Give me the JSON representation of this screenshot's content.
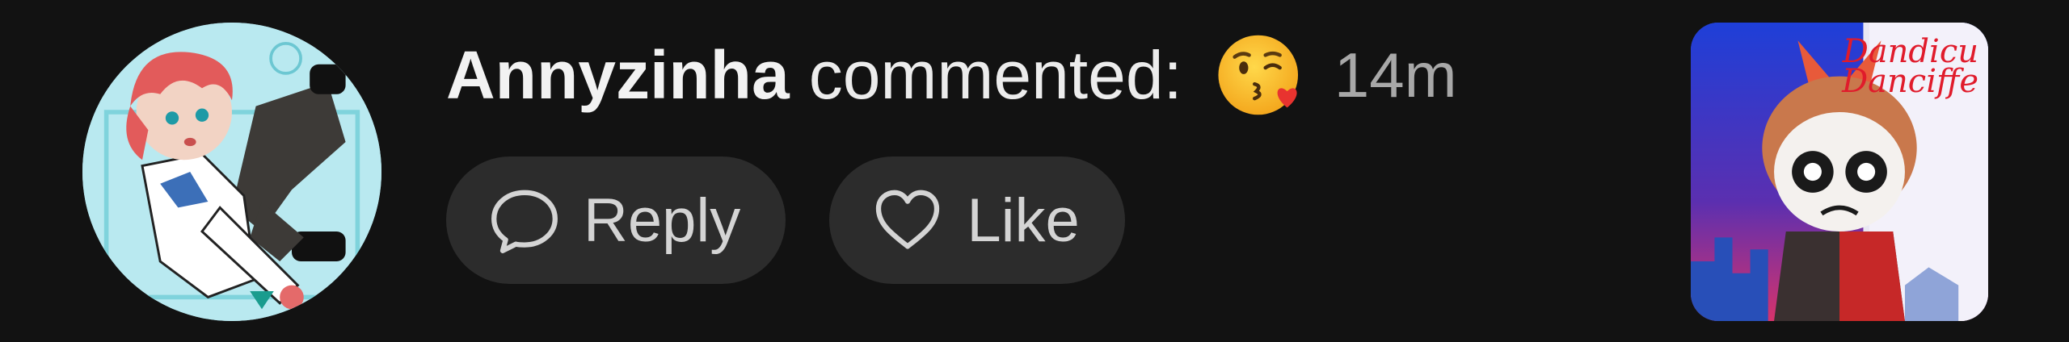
{
  "notification": {
    "author": "Annyzinha",
    "action": "commented:",
    "emoji": "face-blowing-a-kiss",
    "time": "14m"
  },
  "buttons": {
    "reply_label": "Reply",
    "like_label": "Like"
  },
  "thumbnail": {
    "caption_line1": "Dandicu",
    "caption_line2": "Danciffe"
  },
  "colors": {
    "background": "#121212",
    "pill": "#2c2c2c",
    "text": "#ececec",
    "muted": "#a8a8a8"
  },
  "icons": {
    "reply": "speech-bubble-icon",
    "like": "heart-outline-icon"
  }
}
